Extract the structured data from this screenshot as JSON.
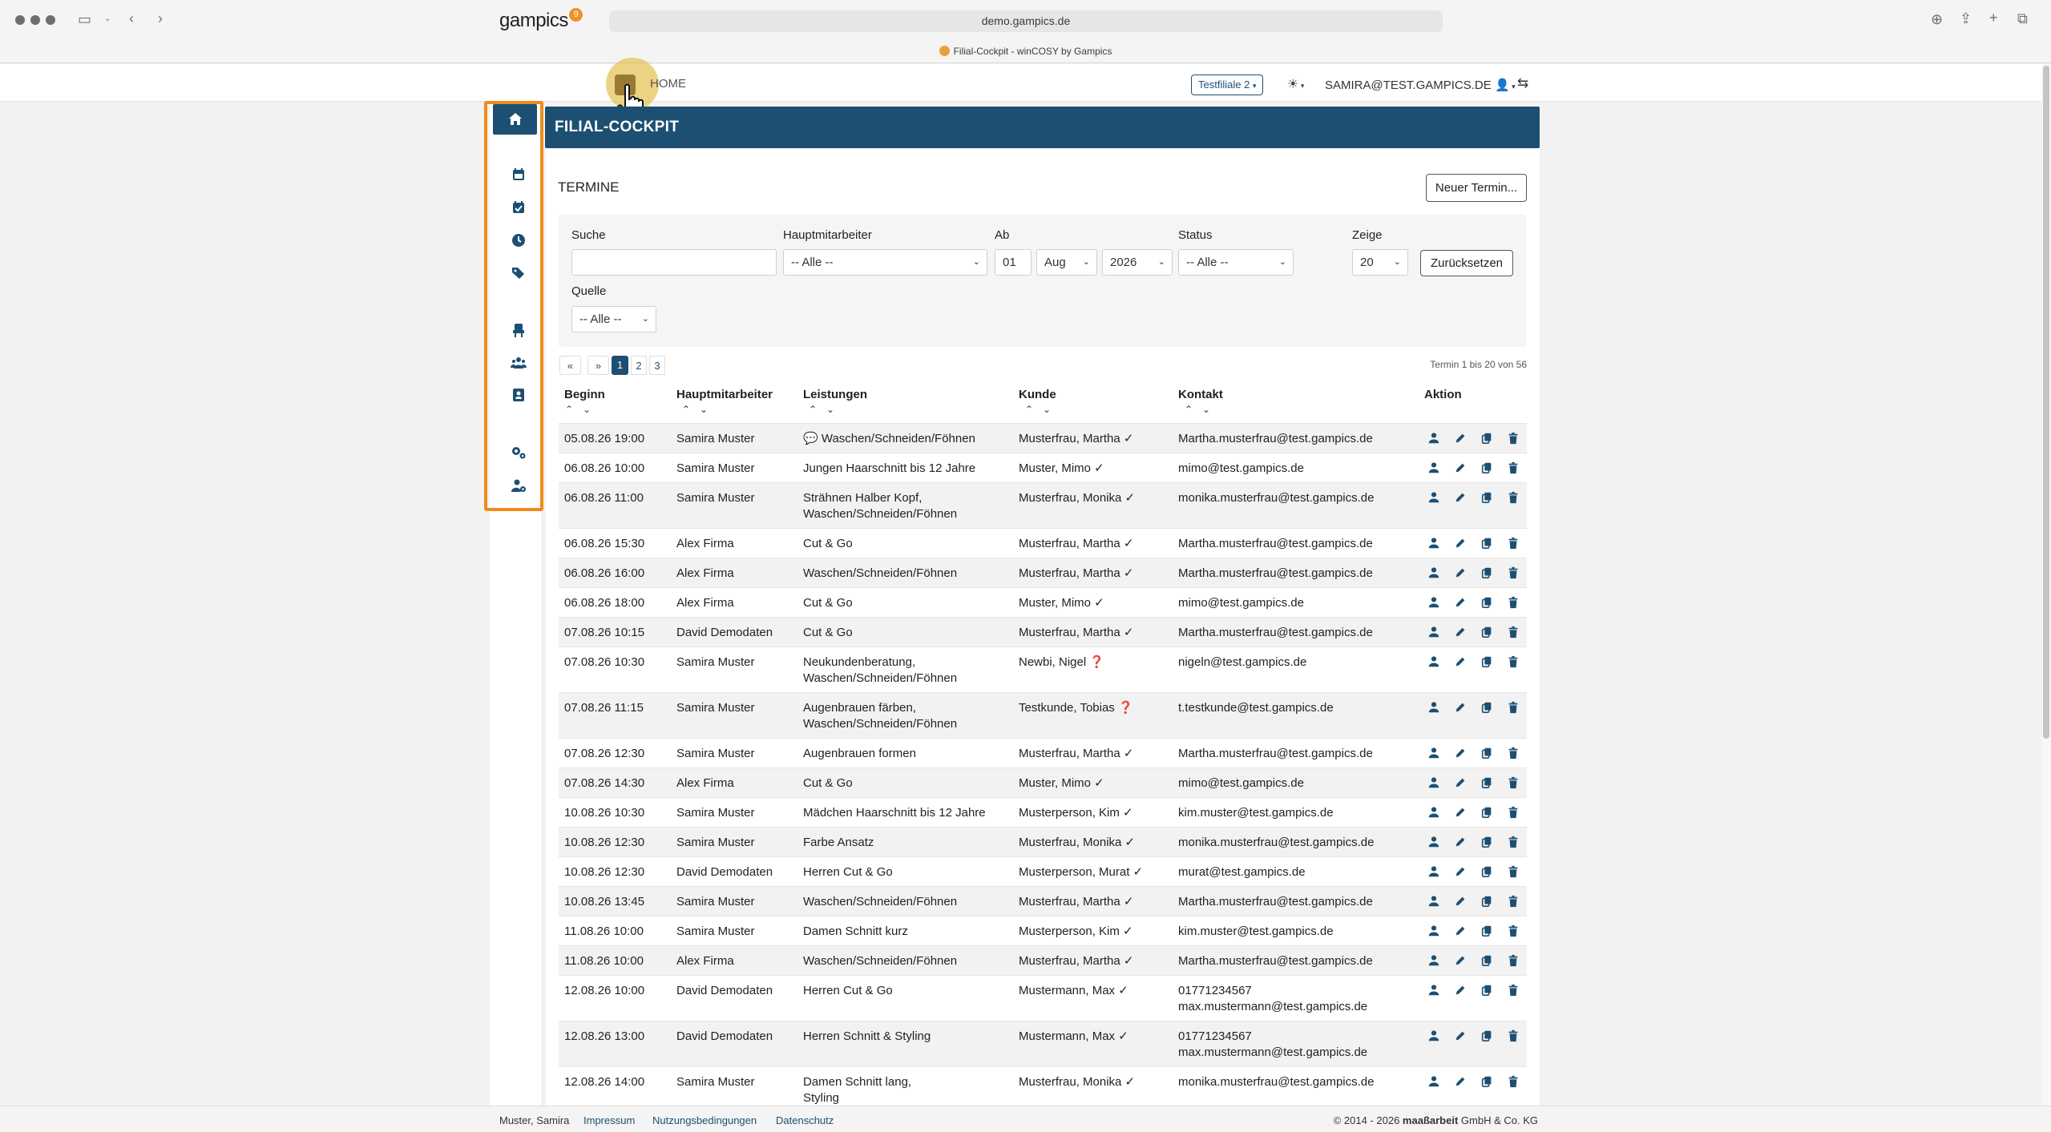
{
  "browser": {
    "url": "demo.gampics.de",
    "tab_title": "Filial-Cockpit - winCOSY by Gampics"
  },
  "header": {
    "logo": "gampics",
    "logo_badge": "9",
    "home_label": "HOME",
    "branch": "Testfiliale 2",
    "user": "SAMIRA@TEST.GAMPICS.DE"
  },
  "page": {
    "title": "FILIAL-COCKPIT",
    "section": "TERMINE",
    "new_button": "Neuer Termin..."
  },
  "filters": {
    "search_label": "Suche",
    "search_value": "",
    "employee_label": "Hauptmitarbeiter",
    "employee_value": "-- Alle --",
    "from_label": "Ab",
    "from_day": "01",
    "from_month": "Aug",
    "from_year": "2026",
    "status_label": "Status",
    "status_value": "-- Alle --",
    "show_label": "Zeige",
    "show_value": "20",
    "reset_button": "Zurücksetzen",
    "source_label": "Quelle",
    "source_value": "-- Alle --"
  },
  "pagination": {
    "first_icon": "double-left-icon",
    "next_icon": "double-right-icon",
    "pages": [
      "1",
      "2",
      "3"
    ],
    "active": "1",
    "count_text": "Termin 1 bis 20 von 56"
  },
  "table": {
    "columns": [
      "Beginn",
      "Hauptmitarbeiter",
      "Leistungen",
      "Kunde",
      "Kontakt",
      "Aktion"
    ],
    "rows": [
      {
        "beginn": "05.08.26 19:00",
        "mitarbeiter": "Samira Muster",
        "leistungen": [
          "💬 Waschen/Schneiden/Föhnen"
        ],
        "kunde": "Musterfrau, Martha ✓",
        "kontakt": [
          "Martha.musterfrau@test.gampics.de"
        ]
      },
      {
        "beginn": "06.08.26 10:00",
        "mitarbeiter": "Samira Muster",
        "leistungen": [
          "Jungen Haarschnitt bis 12 Jahre"
        ],
        "kunde": "Muster, Mimo ✓",
        "kontakt": [
          "mimo@test.gampics.de"
        ]
      },
      {
        "beginn": "06.08.26 11:00",
        "mitarbeiter": "Samira Muster",
        "leistungen": [
          "Strähnen Halber Kopf,",
          "Waschen/Schneiden/Föhnen"
        ],
        "kunde": "Musterfrau, Monika ✓",
        "kontakt": [
          "monika.musterfrau@test.gampics.de"
        ]
      },
      {
        "beginn": "06.08.26 15:30",
        "mitarbeiter": "Alex Firma",
        "leistungen": [
          "Cut & Go"
        ],
        "kunde": "Musterfrau, Martha ✓",
        "kontakt": [
          "Martha.musterfrau@test.gampics.de"
        ]
      },
      {
        "beginn": "06.08.26 16:00",
        "mitarbeiter": "Alex Firma",
        "leistungen": [
          "Waschen/Schneiden/Föhnen"
        ],
        "kunde": "Musterfrau, Martha ✓",
        "kontakt": [
          "Martha.musterfrau@test.gampics.de"
        ]
      },
      {
        "beginn": "06.08.26 18:00",
        "mitarbeiter": "Alex Firma",
        "leistungen": [
          "Cut & Go"
        ],
        "kunde": "Muster, Mimo ✓",
        "kontakt": [
          "mimo@test.gampics.de"
        ]
      },
      {
        "beginn": "07.08.26 10:15",
        "mitarbeiter": "David Demodaten",
        "leistungen": [
          "Cut & Go"
        ],
        "kunde": "Musterfrau, Martha ✓",
        "kontakt": [
          "Martha.musterfrau@test.gampics.de"
        ]
      },
      {
        "beginn": "07.08.26 10:30",
        "mitarbeiter": "Samira Muster",
        "leistungen": [
          "Neukundenberatung,",
          "Waschen/Schneiden/Föhnen"
        ],
        "kunde": "Newbi, Nigel ❓",
        "kontakt": [
          "nigeln@test.gampics.de"
        ]
      },
      {
        "beginn": "07.08.26 11:15",
        "mitarbeiter": "Samira Muster",
        "leistungen": [
          "Augenbrauen färben,",
          "Waschen/Schneiden/Föhnen"
        ],
        "kunde": "Testkunde, Tobias ❓",
        "kontakt": [
          "t.testkunde@test.gampics.de"
        ]
      },
      {
        "beginn": "07.08.26 12:30",
        "mitarbeiter": "Samira Muster",
        "leistungen": [
          "Augenbrauen formen"
        ],
        "kunde": "Musterfrau, Martha ✓",
        "kontakt": [
          "Martha.musterfrau@test.gampics.de"
        ]
      },
      {
        "beginn": "07.08.26 14:30",
        "mitarbeiter": "Alex Firma",
        "leistungen": [
          "Cut & Go"
        ],
        "kunde": "Muster, Mimo ✓",
        "kontakt": [
          "mimo@test.gampics.de"
        ]
      },
      {
        "beginn": "10.08.26 10:30",
        "mitarbeiter": "Samira Muster",
        "leistungen": [
          "Mädchen Haarschnitt bis 12 Jahre"
        ],
        "kunde": "Musterperson, Kim ✓",
        "kontakt": [
          "kim.muster@test.gampics.de"
        ]
      },
      {
        "beginn": "10.08.26 12:30",
        "mitarbeiter": "Samira Muster",
        "leistungen": [
          "Farbe Ansatz"
        ],
        "kunde": "Musterfrau, Monika ✓",
        "kontakt": [
          "monika.musterfrau@test.gampics.de"
        ]
      },
      {
        "beginn": "10.08.26 12:30",
        "mitarbeiter": "David Demodaten",
        "leistungen": [
          "Herren Cut & Go"
        ],
        "kunde": "Musterperson, Murat ✓",
        "kontakt": [
          "murat@test.gampics.de"
        ]
      },
      {
        "beginn": "10.08.26 13:45",
        "mitarbeiter": "Samira Muster",
        "leistungen": [
          "Waschen/Schneiden/Föhnen"
        ],
        "kunde": "Musterfrau, Martha ✓",
        "kontakt": [
          "Martha.musterfrau@test.gampics.de"
        ]
      },
      {
        "beginn": "11.08.26 10:00",
        "mitarbeiter": "Samira Muster",
        "leistungen": [
          "Damen Schnitt kurz"
        ],
        "kunde": "Musterperson, Kim ✓",
        "kontakt": [
          "kim.muster@test.gampics.de"
        ]
      },
      {
        "beginn": "11.08.26 10:00",
        "mitarbeiter": "Alex Firma",
        "leistungen": [
          "Waschen/Schneiden/Föhnen"
        ],
        "kunde": "Musterfrau, Martha ✓",
        "kontakt": [
          "Martha.musterfrau@test.gampics.de"
        ]
      },
      {
        "beginn": "12.08.26 10:00",
        "mitarbeiter": "David Demodaten",
        "leistungen": [
          "Herren Cut & Go"
        ],
        "kunde": "Mustermann, Max ✓",
        "kontakt": [
          "01771234567",
          "max.mustermann@test.gampics.de"
        ]
      },
      {
        "beginn": "12.08.26 13:00",
        "mitarbeiter": "David Demodaten",
        "leistungen": [
          "Herren Schnitt & Styling"
        ],
        "kunde": "Mustermann, Max ✓",
        "kontakt": [
          "01771234567",
          "max.mustermann@test.gampics.de"
        ]
      },
      {
        "beginn": "12.08.26 14:00",
        "mitarbeiter": "Samira Muster",
        "leistungen": [
          "Damen Schnitt lang,",
          "Styling"
        ],
        "kunde": "Musterfrau, Monika ✓",
        "kontakt": [
          "monika.musterfrau@test.gampics.de"
        ]
      }
    ]
  },
  "sidebar": {
    "items": [
      {
        "name": "home",
        "icon": "home-icon"
      },
      {
        "name": "calendar",
        "icon": "calendar-icon"
      },
      {
        "name": "appointment",
        "icon": "calendar-check-icon"
      },
      {
        "name": "time",
        "icon": "clock-icon"
      },
      {
        "name": "tags",
        "icon": "tags-icon"
      },
      {
        "name": "chair",
        "icon": "chair-icon"
      },
      {
        "name": "customers",
        "icon": "users-icon"
      },
      {
        "name": "contacts",
        "icon": "address-book-icon"
      },
      {
        "name": "settings",
        "icon": "gears-icon"
      },
      {
        "name": "user-settings",
        "icon": "user-gear-icon"
      }
    ]
  },
  "footer": {
    "user": "Muster, Samira",
    "links": [
      "Impressum",
      "Nutzungsbedingungen",
      "Datenschutz"
    ],
    "copyright_prefix": "© 2014 - 2026 ",
    "copyright_brand": "maaßarbeit",
    "copyright_suffix": " GmbH & Co. KG"
  },
  "colors": {
    "primary": "#1d4f73",
    "highlight": "#f18a1a",
    "accent": "#ef8f2d"
  }
}
